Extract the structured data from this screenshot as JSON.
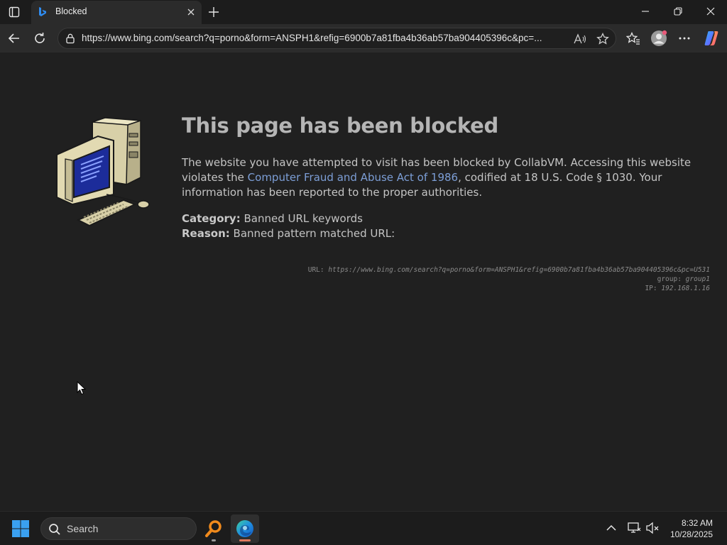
{
  "browser": {
    "tab_title": "Blocked",
    "url": "https://www.bing.com/search?q=porno&form=ANSPH1&refig=6900b7a81fba4b36ab57ba904405396c&pc=..."
  },
  "page": {
    "title": "This page has been blocked",
    "message_part1": "The website you have attempted to visit has been blocked by CollabVM. Accessing this website violates the ",
    "link_text": "Computer Fraud and Abuse Act of 1986",
    "message_part2": ", codified at 18 U.S. Code § 1030. Your information has been reported to the proper authorities.",
    "category_label": "Category:",
    "category_value": "Banned URL keywords",
    "reason_label": "Reason:",
    "reason_value": "Banned pattern matched URL:",
    "meta": {
      "url_label": "URL:",
      "url_value": "https://www.bing.com/search?q=porno&form=ANSPH1&refig=6900b7a81fba4b36ab57ba904405396c&pc=U531",
      "group_label": "group:",
      "group_value": "group1",
      "ip_label": "IP:",
      "ip_value": "192.168.1.16"
    }
  },
  "taskbar": {
    "search_label": "Search",
    "time": "8:32 AM",
    "date": "10/28/2025"
  },
  "colors": {
    "link": "#7c9ed6",
    "edge_indicator": "#e07a5f",
    "windows_blue": "#3aa0f0"
  }
}
